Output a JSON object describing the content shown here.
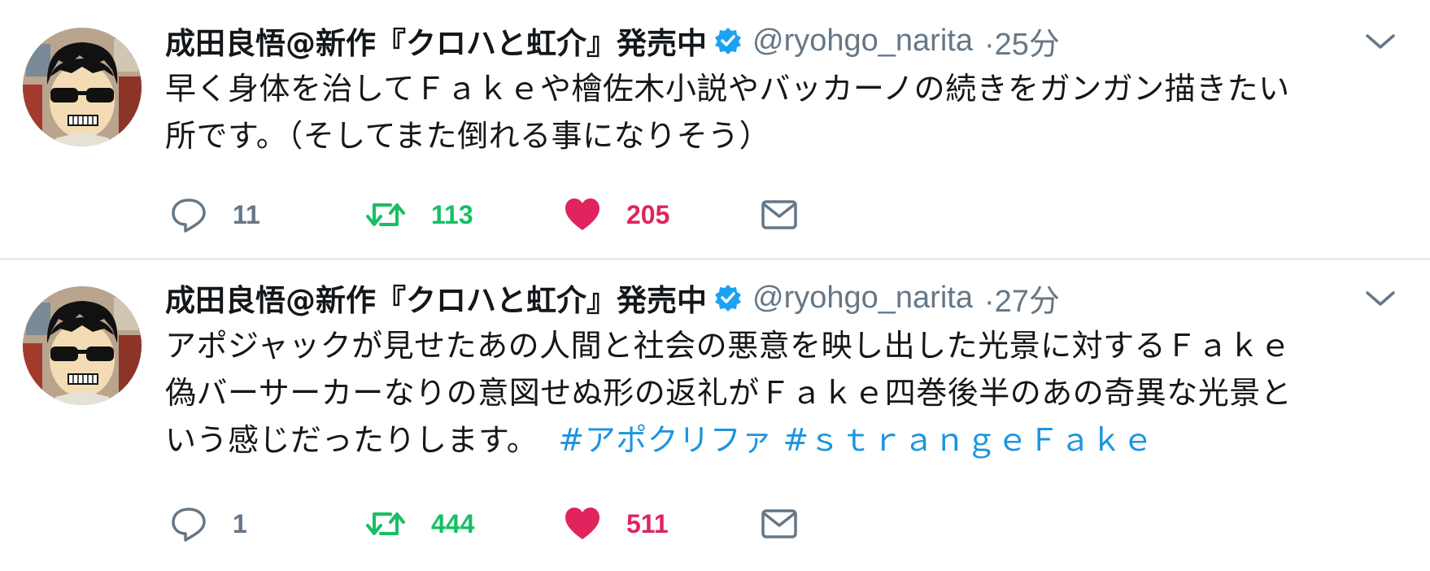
{
  "tweets": [
    {
      "author": {
        "display_name": "成田良悟@新作『クロハと虹介』発売中",
        "handle": "@ryohgo_narita",
        "verified": true
      },
      "timestamp": "·25分",
      "text_lines": [
        "早く身体を治してＦａｋｅや檜佐木小説やバッカーノの続きをガンガン描きたい",
        "所です。（そしてまた倒れる事になりそう）"
      ],
      "hashtags": [],
      "counts": {
        "replies": "11",
        "retweets": "113",
        "likes": "205"
      }
    },
    {
      "author": {
        "display_name": "成田良悟@新作『クロハと虹介』発売中",
        "handle": "@ryohgo_narita",
        "verified": true
      },
      "timestamp": "·27分",
      "text_lines": [
        "アポジャックが見せたあの人間と社会の悪意を映し出した光景に対するＦａｋｅ",
        "偽バーサーカーなりの意図せぬ形の返礼がＦａｋｅ四巻後半のあの奇異な光景と",
        "いう感じだったりします。"
      ],
      "hashtags": [
        "#アポクリファ",
        "#ｓｔｒａｎｇｅＦａｋｅ"
      ],
      "counts": {
        "replies": "1",
        "retweets": "444",
        "likes": "511"
      }
    }
  ],
  "icons": {
    "verified": "verified-badge-icon",
    "caret": "chevron-down-icon",
    "reply": "reply-bubble-icon",
    "retweet": "retweet-icon",
    "like": "heart-icon",
    "dm": "envelope-icon"
  },
  "colors": {
    "name": "#14171a",
    "muted": "#657786",
    "retweet": "#17bf63",
    "like": "#e0245e",
    "link": "#1b95e0",
    "verified": "#1da1f2"
  }
}
